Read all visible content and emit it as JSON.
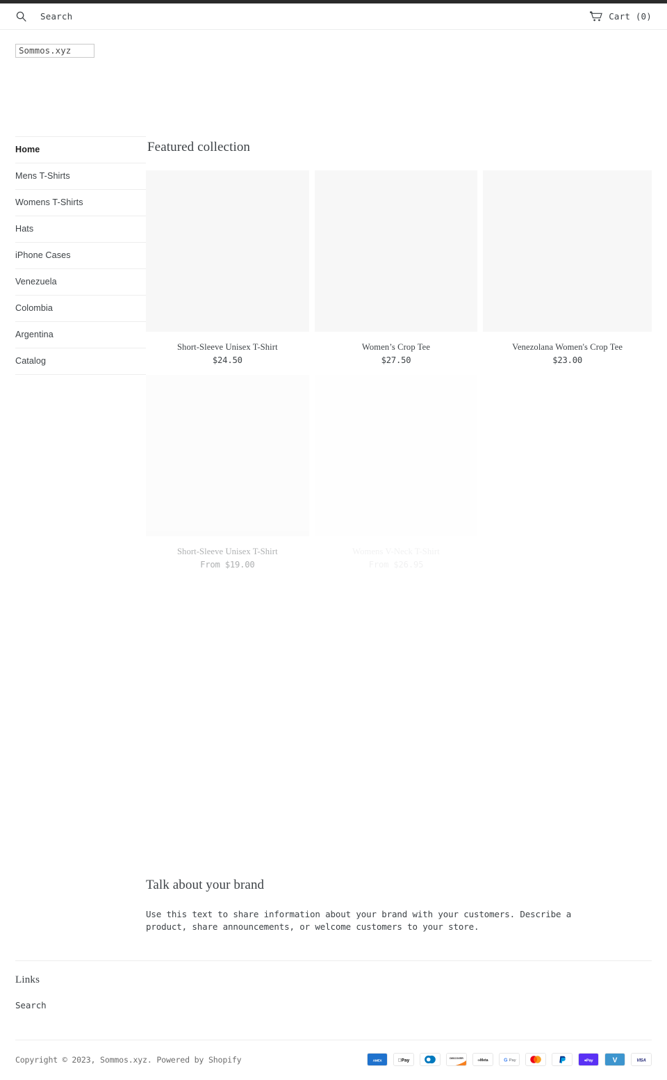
{
  "header": {
    "search_label": "Search",
    "search_icon": "search-icon",
    "cart_label": "Cart (0)",
    "cart_icon": "shopping-cart-icon"
  },
  "logo": {
    "alt_text": "Sommos.xyz"
  },
  "sidebar": {
    "items": [
      {
        "label": "Home",
        "active": true
      },
      {
        "label": "Mens T-Shirts",
        "active": false
      },
      {
        "label": "Womens T-Shirts",
        "active": false
      },
      {
        "label": "Hats",
        "active": false
      },
      {
        "label": "iPhone Cases",
        "active": false
      },
      {
        "label": "Venezuela",
        "active": false
      },
      {
        "label": "Colombia",
        "active": false
      },
      {
        "label": "Argentina",
        "active": false
      },
      {
        "label": "Catalog",
        "active": false
      }
    ]
  },
  "featured": {
    "title": "Featured collection",
    "products": [
      {
        "title": "Short-Sleeve Unisex T-Shirt",
        "price": "$24.50",
        "fade": "none"
      },
      {
        "title": "Women’s Crop Tee",
        "price": "$27.50",
        "fade": "none"
      },
      {
        "title": "Venezolana Women's Crop Tee",
        "price": "$23.00",
        "fade": "none"
      },
      {
        "title": "Short-Sleeve Unisex T-Shirt",
        "price": "From $19.00",
        "fade": "mid"
      },
      {
        "title": "Womens V-Neck T-Shirt",
        "price": "From $26.95",
        "fade": "low"
      }
    ]
  },
  "brand": {
    "title": "Talk about your brand",
    "text": "Use this text to share information about your brand with your customers. Describe a product, share announcements, or welcome customers to your store."
  },
  "footer": {
    "links_heading": "Links",
    "links": [
      {
        "label": "Search"
      }
    ],
    "copyright": "Copyright © 2023, Sommos.xyz. Powered by Shopify",
    "payment_methods": [
      {
        "name": "american-express",
        "label": "AMEX"
      },
      {
        "name": "apple-pay",
        "label": "Apple Pay"
      },
      {
        "name": "diners-club",
        "label": "Diners Club"
      },
      {
        "name": "discover",
        "label": "DISCOVER"
      },
      {
        "name": "meta-pay",
        "label": "Meta"
      },
      {
        "name": "google-pay",
        "label": "G Pay"
      },
      {
        "name": "mastercard",
        "label": "Mastercard"
      },
      {
        "name": "paypal",
        "label": "PayPal"
      },
      {
        "name": "shop-pay",
        "label": "Shop Pay"
      },
      {
        "name": "venmo",
        "label": "Venmo"
      },
      {
        "name": "visa",
        "label": "VISA"
      }
    ]
  },
  "colors": {
    "top_strip": "#2b2b2b",
    "text": "#3d4246",
    "rule": "#ededed",
    "media_placeholder": "#f7f7f7"
  }
}
